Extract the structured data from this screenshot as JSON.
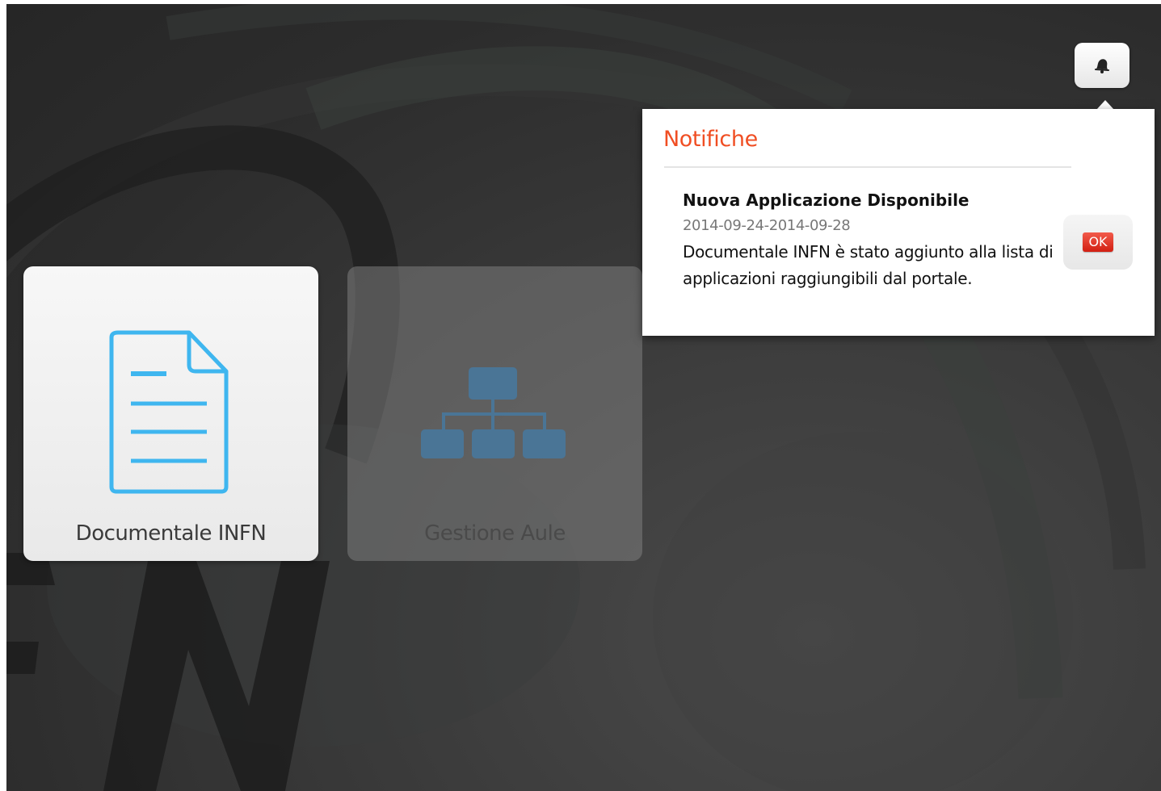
{
  "apps": [
    {
      "label": "Documentale INFN",
      "icon": "document-icon",
      "enabled": true
    },
    {
      "label": "Gestione Aule",
      "icon": "sitemap-icon",
      "enabled": false
    }
  ],
  "notifications": {
    "bell_icon": "bell-icon",
    "panel_title": "Notifiche",
    "items": [
      {
        "title": "Nuova Applicazione Disponibile",
        "date": "2014-09-24-2014-09-28",
        "text": "Documentale INFN è stato aggiunto alla lista di applicazioni raggiungibili dal portale.",
        "ok_label": "OK"
      }
    ]
  },
  "colors": {
    "accent": "#f04e23",
    "doc_icon": "#3fb6ef",
    "sitemap_icon": "#4a7596",
    "ok_button": "#e0281a"
  }
}
